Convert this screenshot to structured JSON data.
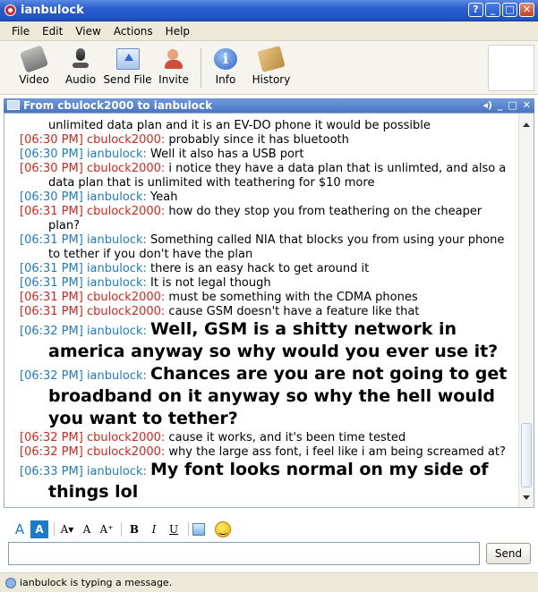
{
  "window": {
    "title": "ianbulock",
    "buttons": [
      "?",
      "_",
      "□",
      "✕"
    ]
  },
  "menu": [
    "File",
    "Edit",
    "View",
    "Actions",
    "Help"
  ],
  "toolbar": {
    "video": "Video",
    "audio": "Audio",
    "send_file": "Send File",
    "invite": "Invite",
    "info": "Info",
    "history": "History"
  },
  "chat": {
    "header": "From cbulock2000 to ianbulock",
    "messages": [
      {
        "time": "",
        "user": "",
        "text": "unlimited data plan and it is an EV-DO phone it would be possible",
        "side": "cont"
      },
      {
        "time": "[06:30 PM]",
        "user": "cbulock2000:",
        "text": "probably since it has bluetooth",
        "side": "them"
      },
      {
        "time": "[06:30 PM]",
        "user": "ianbulock:",
        "text": "Well it also has a USB port",
        "side": "me"
      },
      {
        "time": "[06:30 PM]",
        "user": "cbulock2000:",
        "text": "i notice they have a data plan that is unlimted, and also a data plan that is unlimited with teathering for $10 more",
        "side": "them"
      },
      {
        "time": "[06:30 PM]",
        "user": "ianbulock:",
        "text": "Yeah",
        "side": "me"
      },
      {
        "time": "[06:31 PM]",
        "user": "cbulock2000:",
        "text": "how do they stop you from teathering on the cheaper plan?",
        "side": "them"
      },
      {
        "time": "[06:31 PM]",
        "user": "ianbulock:",
        "text": "Something called NIA that blocks you from using your phone to tether if you don't have the plan",
        "side": "me"
      },
      {
        "time": "[06:31 PM]",
        "user": "ianbulock:",
        "text": "there is an easy hack to get around it",
        "side": "me"
      },
      {
        "time": "[06:31 PM]",
        "user": "ianbulock:",
        "text": "It is not legal though",
        "side": "me"
      },
      {
        "time": "[06:31 PM]",
        "user": "cbulock2000:",
        "text": "must be something with the CDMA phones",
        "side": "them"
      },
      {
        "time": "[06:31 PM]",
        "user": "cbulock2000:",
        "text": "cause GSM doesn't have a feature like that",
        "side": "them"
      },
      {
        "time": "[06:32 PM]",
        "user": "ianbulock:",
        "text": "Well, GSM is a shitty network in america anyway so why would you ever use it?",
        "side": "me",
        "big": true
      },
      {
        "time": "[06:32 PM]",
        "user": "ianbulock:",
        "text": "Chances are you are not going to get broadband on it anyway so why the hell would you want to tether?",
        "side": "me",
        "big": true
      },
      {
        "time": "[06:32 PM]",
        "user": "cbulock2000:",
        "text": "cause it works, and it's been time tested",
        "side": "them"
      },
      {
        "time": "[06:32 PM]",
        "user": "cbulock2000:",
        "text": "why the large ass font, i feel like i am being screamed at?",
        "side": "them"
      },
      {
        "time": "[06:33 PM]",
        "user": "ianbulock:",
        "text": "My font looks normal on my side of things lol",
        "side": "me",
        "big": true
      }
    ]
  },
  "format_bar": [
    "A",
    "A",
    "A▾",
    "A",
    "A⁺",
    "B",
    "I",
    "U"
  ],
  "compose": {
    "value": "",
    "send_label": "Send"
  },
  "status": {
    "text": "ianbulock is typing a message."
  },
  "colors": {
    "me": "#1f7bc8",
    "them": "#d8261c",
    "title_bar": "#2a5fcf"
  }
}
